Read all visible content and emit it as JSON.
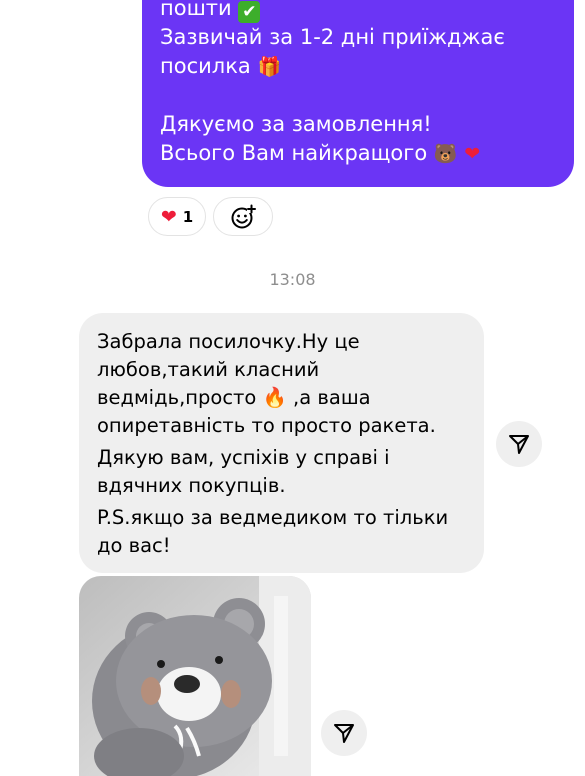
{
  "sent_message": {
    "lines": [
      "пошти",
      "Зазвичай за 1-2 дні приїжджає",
      "посилка",
      "Дякуємо за замовлення!",
      "Всього Вам найкращого"
    ],
    "emojis": [
      "✔",
      "🎁",
      "🐻",
      "❤"
    ]
  },
  "reaction": {
    "emoji": "❤",
    "count": "1"
  },
  "timestamp": "13:08",
  "received_message": {
    "paragraphs": [
      [
        "Забрала посилочку.Ну це",
        "любов,такий класний",
        "ведмідь,просто",
        ",а ваша",
        "опиретавність то просто ракета."
      ],
      [
        "Дякую вам, успіхів у справі і",
        "вдячних покупців."
      ],
      [
        "P.S.якщо за ведмедиком то тільки",
        "до вас!"
      ]
    ],
    "emoji_fire": "🔥"
  },
  "photo": {
    "icon": "teddy-bear-photo"
  },
  "icons": {
    "add_reaction": "add-reaction-icon",
    "share": "share-icon"
  },
  "colors": {
    "sent_bubble": "#6b35f5",
    "received_bubble": "#efefef",
    "timestamp": "#8e8e8e"
  }
}
